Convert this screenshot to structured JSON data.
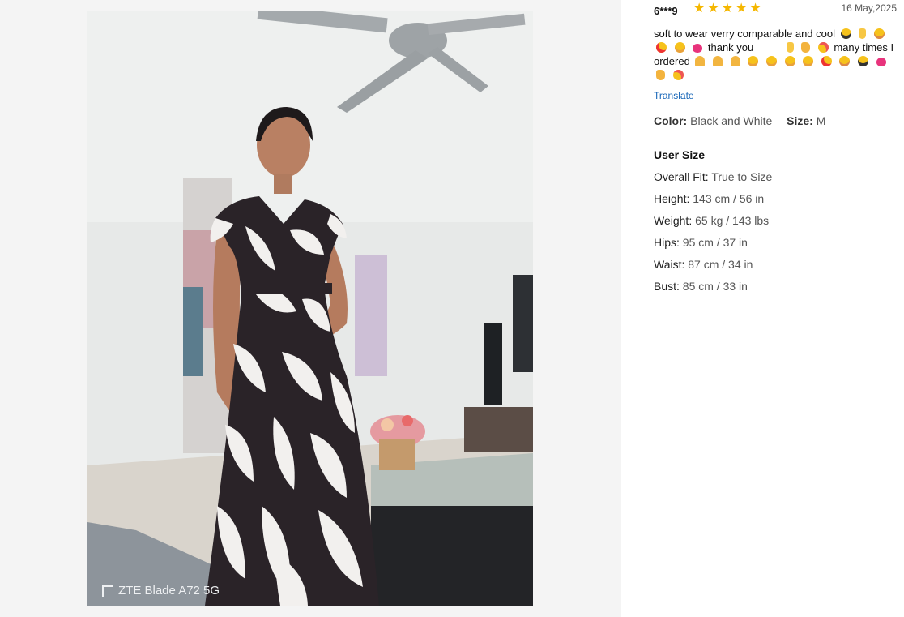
{
  "review": {
    "user": "6***9",
    "rating": 5,
    "date": "16 May,2025",
    "text_parts": {
      "p1": "soft to wear verry comparable and cool",
      "p2": "thank you",
      "p3": "many times I ordered"
    },
    "translate_label": "Translate",
    "color_label": "Color:",
    "color_value": "Black and White",
    "size_label": "Size:",
    "size_value": "M"
  },
  "user_size": {
    "title": "User Size",
    "rows": [
      {
        "label": "Overall Fit:",
        "value": "True to Size"
      },
      {
        "label": "Height:",
        "value": "143 cm / 56 in"
      },
      {
        "label": "Weight:",
        "value": "65 kg / 143 lbs"
      },
      {
        "label": "Hips:",
        "value": "95 cm / 37 in"
      },
      {
        "label": "Waist:",
        "value": "87 cm / 34 in"
      },
      {
        "label": "Bust:",
        "value": "85 cm / 33 in"
      }
    ]
  },
  "photo": {
    "watermark": "ZTE Blade A72 5G"
  },
  "colors": {
    "star": "#f5b700",
    "link": "#1766b8",
    "dress_dark": "#2a2328",
    "dress_light": "#f2f0ee"
  }
}
